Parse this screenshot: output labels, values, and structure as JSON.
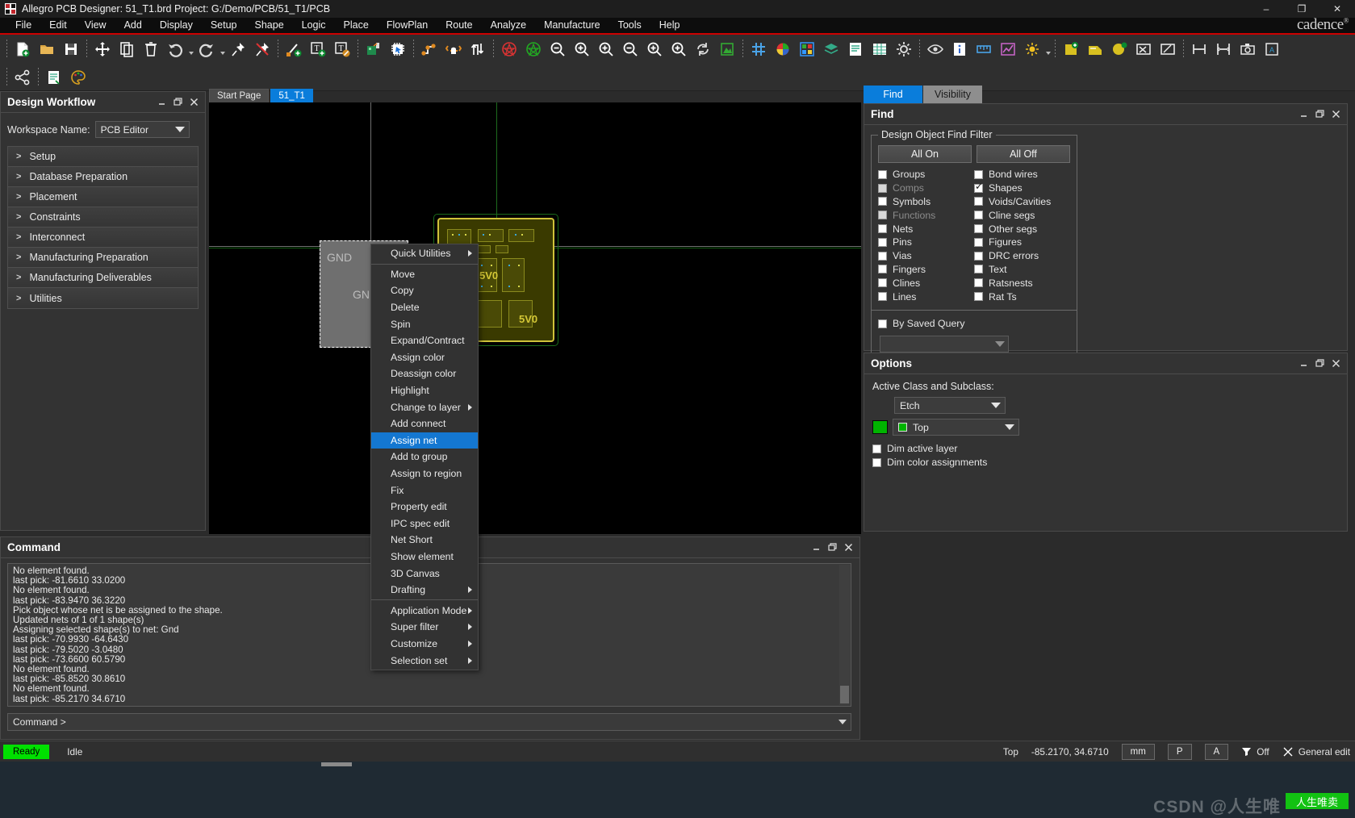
{
  "window": {
    "title": "Allegro PCB Designer: 51_T1.brd  Project: G:/Demo/PCB/51_T1/PCB",
    "minimize": "–",
    "maximize": "❐",
    "close": "✕",
    "brand": "cadence",
    "brand_sup": "®",
    "accent_blue": "#0a7ddb",
    "accent_red": "#cc0000",
    "panel_bg": "#333333"
  },
  "menubar": {
    "items": [
      "File",
      "Edit",
      "View",
      "Add",
      "Display",
      "Setup",
      "Shape",
      "Logic",
      "Place",
      "FlowPlan",
      "Route",
      "Analyze",
      "Manufacture",
      "Tools",
      "Help"
    ]
  },
  "design_workflow": {
    "title": "Design Workflow",
    "workspace_label": "Workspace Name:",
    "workspace_value": "PCB Editor",
    "items": [
      {
        "label": "Setup"
      },
      {
        "label": "Database Preparation"
      },
      {
        "label": "Placement"
      },
      {
        "label": "Constraints"
      },
      {
        "label": "Interconnect"
      },
      {
        "label": "Manufacturing Preparation"
      },
      {
        "label": "Manufacturing Deliverables"
      },
      {
        "label": "Utilities"
      }
    ]
  },
  "canvas": {
    "tabs": [
      {
        "label": "Start Page",
        "active": false
      },
      {
        "label": "51_T1",
        "active": true
      }
    ],
    "shape_label_1": "GND",
    "shape_label_2": "GND",
    "board_label_1": "5V0",
    "board_label_2": "5V0"
  },
  "context_menu": {
    "items": [
      {
        "label": "Quick Utilities",
        "submenu": true,
        "selected": false,
        "separator_after": true
      },
      {
        "label": "Move",
        "submenu": false,
        "selected": false
      },
      {
        "label": "Copy",
        "submenu": false,
        "selected": false
      },
      {
        "label": "Delete",
        "submenu": false,
        "selected": false
      },
      {
        "label": "Spin",
        "submenu": false,
        "selected": false
      },
      {
        "label": "Expand/Contract",
        "submenu": false,
        "selected": false
      },
      {
        "label": "Assign color",
        "submenu": false,
        "selected": false
      },
      {
        "label": "Deassign color",
        "submenu": false,
        "selected": false
      },
      {
        "label": "Highlight",
        "submenu": false,
        "selected": false
      },
      {
        "label": "Change to layer",
        "submenu": true,
        "selected": false
      },
      {
        "label": "Add connect",
        "submenu": false,
        "selected": false
      },
      {
        "label": "Assign net",
        "submenu": false,
        "selected": true
      },
      {
        "label": "Add to group",
        "submenu": false,
        "selected": false
      },
      {
        "label": "Assign to region",
        "submenu": false,
        "selected": false
      },
      {
        "label": "Fix",
        "submenu": false,
        "selected": false
      },
      {
        "label": "Property edit",
        "submenu": false,
        "selected": false
      },
      {
        "label": "IPC spec edit",
        "submenu": false,
        "selected": false
      },
      {
        "label": "Net Short",
        "submenu": false,
        "selected": false
      },
      {
        "label": "Show element",
        "submenu": false,
        "selected": false
      },
      {
        "label": "3D Canvas",
        "submenu": false,
        "selected": false
      },
      {
        "label": "Drafting",
        "submenu": true,
        "selected": false,
        "separator_after": true
      },
      {
        "label": "Application Mode",
        "submenu": true,
        "selected": false
      },
      {
        "label": "Super filter",
        "submenu": true,
        "selected": false
      },
      {
        "label": "Customize",
        "submenu": true,
        "selected": false
      },
      {
        "label": "Selection set",
        "submenu": true,
        "selected": false
      }
    ]
  },
  "right_panel": {
    "tabs": [
      {
        "label": "Find",
        "active": true
      },
      {
        "label": "Visibility",
        "active": false
      }
    ],
    "find": {
      "title": "Find",
      "group_legend": "Design Object Find Filter",
      "all_on": "All On",
      "all_off": "All Off",
      "filters_left": [
        {
          "label": "Groups",
          "checked": false,
          "dim": false
        },
        {
          "label": "Comps",
          "checked": false,
          "dim": true
        },
        {
          "label": "Symbols",
          "checked": false,
          "dim": false
        },
        {
          "label": "Functions",
          "checked": false,
          "dim": true
        },
        {
          "label": "Nets",
          "checked": false,
          "dim": false
        },
        {
          "label": "Pins",
          "checked": false,
          "dim": false
        },
        {
          "label": "Vias",
          "checked": false,
          "dim": false
        },
        {
          "label": "Fingers",
          "checked": false,
          "dim": false
        },
        {
          "label": "Clines",
          "checked": false,
          "dim": false
        },
        {
          "label": "Lines",
          "checked": false,
          "dim": false
        }
      ],
      "filters_right": [
        {
          "label": "Bond wires",
          "checked": false,
          "dim": false
        },
        {
          "label": "Shapes",
          "checked": true,
          "dim": false
        },
        {
          "label": "Voids/Cavities",
          "checked": false,
          "dim": false
        },
        {
          "label": "Cline segs",
          "checked": false,
          "dim": false
        },
        {
          "label": "Other segs",
          "checked": false,
          "dim": false
        },
        {
          "label": "Figures",
          "checked": false,
          "dim": false
        },
        {
          "label": "DRC errors",
          "checked": false,
          "dim": false
        },
        {
          "label": "Text",
          "checked": false,
          "dim": false
        },
        {
          "label": "Ratsnests",
          "checked": false,
          "dim": false
        },
        {
          "label": "Rat Ts",
          "checked": false,
          "dim": false
        }
      ],
      "saved_query_label": "By Saved Query",
      "saved_query_checked": false,
      "saved_query_value": ""
    },
    "options": {
      "title": "Options",
      "active_class_label": "Active Class and Subclass:",
      "class_value": "Etch",
      "subclass_value": "Top",
      "subclass_color": "#00b400",
      "dim_active_layer": "Dim active layer",
      "dim_active_layer_checked": false,
      "dim_color_assignments": "Dim color assignments",
      "dim_color_assignments_checked": false
    }
  },
  "command_panel": {
    "title": "Command",
    "log_lines": [
      "No element found.",
      "last pick:  -81.6610 33.0200",
      "No element found.",
      "last pick:  -83.9470 36.3220",
      "Pick object whose net is be assigned to the shape.",
      "Updated nets of 1 of 1 shape(s)",
      "Assigning selected shape(s) to net: Gnd",
      "last pick:  -70.9930 -64.6430",
      "last pick:  -79.5020 -3.0480",
      "last pick:  -73.6600 60.5790",
      "No element found.",
      "last pick:  -85.8520 30.8610",
      "No element found.",
      "last pick:  -85.2170 34.6710"
    ],
    "input_value": "Command >"
  },
  "status_bar": {
    "ready": "Ready",
    "state": "Idle",
    "layer": "Top",
    "coords": "-85.2170, 34.6710",
    "units": "mm",
    "mode_p": "P",
    "mode_a": "A",
    "filter_state": "Off",
    "app_mode": "General edit"
  },
  "watermark": {
    "text": "CSDN @人生唯 ",
    "badge": "人生唯卖"
  }
}
